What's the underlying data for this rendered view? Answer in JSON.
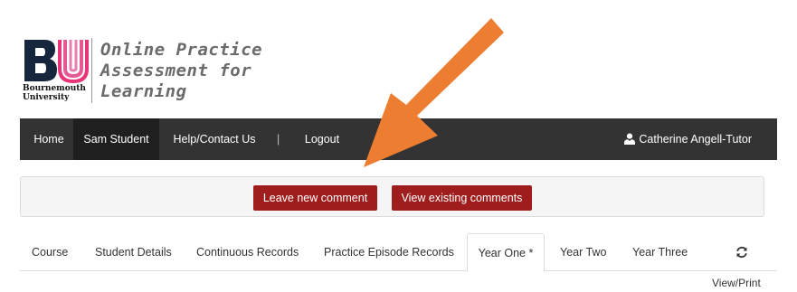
{
  "logo": {
    "line1": "Bournemouth",
    "line2": "University",
    "colors": {
      "b": "#16263d",
      "u_outer": "#e8357a",
      "u_mid": "#e55a95",
      "u_inner": "#e87fb0"
    }
  },
  "app_title": {
    "line1": "Online Practice",
    "line2": "Assessment for",
    "line3": "Learning"
  },
  "nav": {
    "home": "Home",
    "student": "Sam Student",
    "help": "Help/Contact Us",
    "separator": "|",
    "logout": "Logout",
    "user": "Catherine Angell-Tutor",
    "user_icon": "user-icon"
  },
  "comments": {
    "leave": "Leave new comment",
    "view": "View existing comments",
    "button_color": "#a01d1d"
  },
  "tabs": {
    "course": "Course",
    "student_details": "Student Details",
    "continuous_records": "Continuous Records",
    "practice_episode_records": "Practice Episode Records",
    "year_one": "Year One *",
    "year_two": "Year Two",
    "year_three": "Year Three",
    "refresh_icon": "refresh-icon",
    "active": "Year One *"
  },
  "view_print": "View/Print",
  "annotation": {
    "arrow_color": "#ed7d31"
  }
}
